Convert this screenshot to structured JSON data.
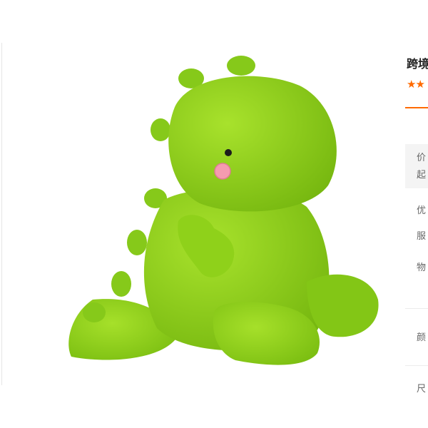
{
  "product": {
    "title": "跨境",
    "rating_stars": 2,
    "body_color": "#8fd11a"
  },
  "price_box": {
    "price_label": "价",
    "moq_label": "起"
  },
  "attributes": [
    {
      "label": "优"
    },
    {
      "label": "服"
    },
    {
      "label": "物"
    }
  ],
  "options": [
    {
      "label": "颜"
    },
    {
      "label": "尺"
    }
  ],
  "colors": {
    "accent": "#ff6a00",
    "plush_green": "#8fd11a",
    "cheek_pink": "#f59bb0"
  }
}
